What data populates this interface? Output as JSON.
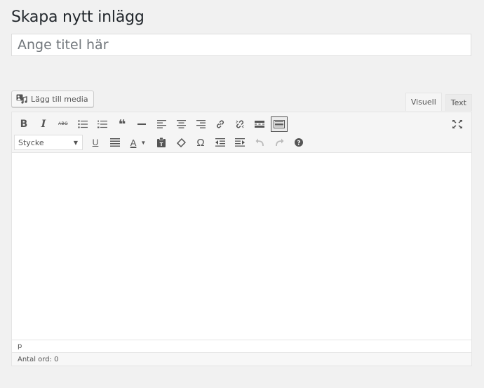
{
  "page": {
    "title": "Skapa nytt inlägg"
  },
  "title_field": {
    "placeholder": "Ange titel här",
    "value": ""
  },
  "media": {
    "button_label": "Lägg till media",
    "icon": "media-icon"
  },
  "tabs": [
    {
      "label": "Visuell",
      "active": true
    },
    {
      "label": "Text",
      "active": false
    }
  ],
  "toolbar": {
    "row1": [
      "bold-icon",
      "italic-icon",
      "strikethrough-icon",
      "bullet-list-icon",
      "numbered-list-icon",
      "blockquote-icon",
      "horizontal-line-icon",
      "align-left-icon",
      "align-center-icon",
      "align-right-icon",
      "link-icon",
      "unlink-icon",
      "read-more-icon",
      "toolbar-toggle-icon"
    ],
    "row2": [
      "format-select",
      "underline-icon",
      "justify-icon",
      "text-color-icon",
      "paste-text-icon",
      "clear-formatting-icon",
      "special-character-icon",
      "outdent-icon",
      "indent-icon",
      "undo-icon",
      "redo-icon",
      "help-icon"
    ],
    "format": {
      "selected": "Stycke"
    },
    "fullscreen_icon": "fullscreen-icon",
    "labels": {
      "bold": "B",
      "italic": "I",
      "strike": "ABC",
      "underline": "U",
      "textcolor": "A",
      "omega": "Ω",
      "quote": "❝"
    }
  },
  "statusbar": {
    "path": "p"
  },
  "wordcount": {
    "text": "Antal ord: 0"
  },
  "colors": {
    "background": "#f1f1f1",
    "border": "#e5e5e5",
    "icon": "#555555",
    "text": "#23282d"
  }
}
